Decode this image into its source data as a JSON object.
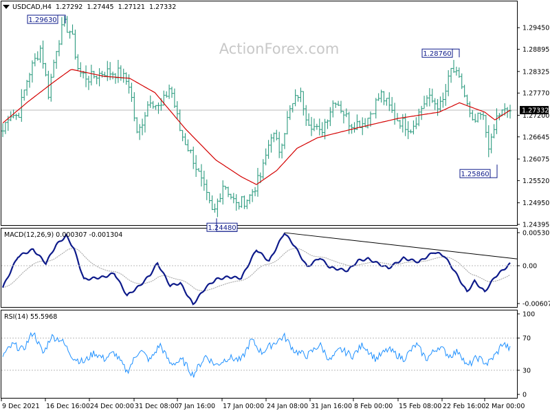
{
  "watermark": "ActionForex.com",
  "chart_data": [
    {
      "type": "candlestick",
      "title": "USDCAD,H4  1.27292  1.27445  1.27121  1.27332",
      "symbol": "USDCAD,H4",
      "ohlc_header": [
        "1.27292",
        "1.27445",
        "1.27121",
        "1.27332"
      ],
      "ylim": [
        1.24395,
        1.3002
      ],
      "y_ticks": [
        "1.29450",
        "1.28895",
        "1.28325",
        "1.27770",
        "1.27200",
        "1.26645",
        "1.26075",
        "1.25520",
        "1.24950",
        "1.24395"
      ],
      "current_price": "1.27332",
      "current_price_value": 1.27332,
      "moving_average_color": "#d40000",
      "bar_color": "#2a9a7e",
      "annotations": [
        {
          "label": "1.29630",
          "date": "16 Dec 2021",
          "value": 1.2963
        },
        {
          "label": "1.24480",
          "date": "17 Jan",
          "value": 1.2448
        },
        {
          "label": "1.28760",
          "date": "22 Feb",
          "value": 1.2876
        },
        {
          "label": "1.25860",
          "date": "28 Feb",
          "value": 1.2586
        }
      ],
      "anchors": [
        {
          "t": 0,
          "v": 1.268
        },
        {
          "t": 0.012,
          "v": 1.2725
        },
        {
          "t": 0.03,
          "v": 1.2718
        },
        {
          "t": 0.05,
          "v": 1.2822
        },
        {
          "t": 0.075,
          "v": 1.2895
        },
        {
          "t": 0.09,
          "v": 1.2776
        },
        {
          "t": 0.105,
          "v": 1.289
        },
        {
          "t": 0.12,
          "v": 1.2955
        },
        {
          "t": 0.135,
          "v": 1.2932
        },
        {
          "t": 0.15,
          "v": 1.283
        },
        {
          "t": 0.17,
          "v": 1.2815
        },
        {
          "t": 0.2,
          "v": 1.2832
        },
        {
          "t": 0.23,
          "v": 1.2828
        },
        {
          "t": 0.25,
          "v": 1.2798
        },
        {
          "t": 0.265,
          "v": 1.2665
        },
        {
          "t": 0.29,
          "v": 1.2765
        },
        {
          "t": 0.31,
          "v": 1.2735
        },
        {
          "t": 0.33,
          "v": 1.2796
        },
        {
          "t": 0.35,
          "v": 1.2678
        },
        {
          "t": 0.375,
          "v": 1.261
        },
        {
          "t": 0.395,
          "v": 1.2535
        },
        {
          "t": 0.415,
          "v": 1.2462
        },
        {
          "t": 0.435,
          "v": 1.2548
        },
        {
          "t": 0.46,
          "v": 1.2488
        },
        {
          "t": 0.485,
          "v": 1.2508
        },
        {
          "t": 0.51,
          "v": 1.2568
        },
        {
          "t": 0.53,
          "v": 1.2678
        },
        {
          "t": 0.545,
          "v": 1.2632
        },
        {
          "t": 0.565,
          "v": 1.2728
        },
        {
          "t": 0.585,
          "v": 1.2782
        },
        {
          "t": 0.6,
          "v": 1.2712
        },
        {
          "t": 0.625,
          "v": 1.2672
        },
        {
          "t": 0.655,
          "v": 1.2764
        },
        {
          "t": 0.685,
          "v": 1.2698
        },
        {
          "t": 0.715,
          "v": 1.2702
        },
        {
          "t": 0.745,
          "v": 1.2775
        },
        {
          "t": 0.775,
          "v": 1.2712
        },
        {
          "t": 0.805,
          "v": 1.2686
        },
        {
          "t": 0.835,
          "v": 1.2764
        },
        {
          "t": 0.865,
          "v": 1.2742
        },
        {
          "t": 0.885,
          "v": 1.2842
        },
        {
          "t": 0.905,
          "v": 1.2795
        },
        {
          "t": 0.925,
          "v": 1.2695
        },
        {
          "t": 0.945,
          "v": 1.2722
        },
        {
          "t": 0.96,
          "v": 1.2632
        },
        {
          "t": 0.975,
          "v": 1.2722
        },
        {
          "t": 1.0,
          "v": 1.2733
        }
      ],
      "ma_anchors": [
        {
          "t": 0,
          "v": 1.27
        },
        {
          "t": 0.05,
          "v": 1.2755
        },
        {
          "t": 0.1,
          "v": 1.2805
        },
        {
          "t": 0.135,
          "v": 1.2838
        },
        {
          "t": 0.2,
          "v": 1.282
        },
        {
          "t": 0.25,
          "v": 1.2815
        },
        {
          "t": 0.3,
          "v": 1.2778
        },
        {
          "t": 0.36,
          "v": 1.2685
        },
        {
          "t": 0.42,
          "v": 1.2605
        },
        {
          "t": 0.47,
          "v": 1.2562
        },
        {
          "t": 0.5,
          "v": 1.2542
        },
        {
          "t": 0.54,
          "v": 1.2578
        },
        {
          "t": 0.58,
          "v": 1.2635
        },
        {
          "t": 0.62,
          "v": 1.2662
        },
        {
          "t": 0.7,
          "v": 1.2688
        },
        {
          "t": 0.78,
          "v": 1.2712
        },
        {
          "t": 0.86,
          "v": 1.2728
        },
        {
          "t": 0.9,
          "v": 1.2752
        },
        {
          "t": 0.95,
          "v": 1.2728
        },
        {
          "t": 0.97,
          "v": 1.2708
        },
        {
          "t": 1.0,
          "v": 1.2733
        }
      ]
    },
    {
      "type": "line",
      "title": "MACD(12,26,9) 0.000307 -0.001304",
      "label": "MACD(12,26,9)",
      "readings": [
        "0.000307",
        "-0.001304"
      ],
      "y_ticks": [
        "0.005307",
        "0.00",
        "-0.006074"
      ],
      "ylim": [
        -0.006074,
        0.005307
      ],
      "macd_color": "#0d1a8a",
      "signal_color": "#a0a0a0",
      "trendline_color": "#000000",
      "trendline": [
        {
          "t": 0.555,
          "v": 0.0053
        },
        {
          "t": 1.0,
          "v": 0.0011
        }
      ],
      "anchors": [
        {
          "t": 0,
          "v": -0.0035
        },
        {
          "t": 0.03,
          "v": 0.0015
        },
        {
          "t": 0.06,
          "v": 0.0026
        },
        {
          "t": 0.085,
          "v": 0.0004
        },
        {
          "t": 0.105,
          "v": 0.0033
        },
        {
          "t": 0.125,
          "v": 0.0048
        },
        {
          "t": 0.14,
          "v": 0.0028
        },
        {
          "t": 0.16,
          "v": -0.0022
        },
        {
          "t": 0.2,
          "v": -0.0018
        },
        {
          "t": 0.22,
          "v": -0.0012
        },
        {
          "t": 0.245,
          "v": -0.0048
        },
        {
          "t": 0.27,
          "v": -0.0032
        },
        {
          "t": 0.29,
          "v": -0.0015
        },
        {
          "t": 0.305,
          "v": 0.0004
        },
        {
          "t": 0.33,
          "v": -0.0032
        },
        {
          "t": 0.35,
          "v": -0.0028
        },
        {
          "t": 0.375,
          "v": -0.0062
        },
        {
          "t": 0.4,
          "v": -0.0035
        },
        {
          "t": 0.42,
          "v": -0.0022
        },
        {
          "t": 0.445,
          "v": -0.0018
        },
        {
          "t": 0.47,
          "v": -0.002
        },
        {
          "t": 0.5,
          "v": 0.0026
        },
        {
          "t": 0.525,
          "v": 0.0007
        },
        {
          "t": 0.555,
          "v": 0.0053
        },
        {
          "t": 0.575,
          "v": 0.0032
        },
        {
          "t": 0.6,
          "v": -0.0002
        },
        {
          "t": 0.625,
          "v": 0.0013
        },
        {
          "t": 0.645,
          "v": -0.0003
        },
        {
          "t": 0.68,
          "v": -0.0008
        },
        {
          "t": 0.7,
          "v": 0.0008
        },
        {
          "t": 0.72,
          "v": 0.0011
        },
        {
          "t": 0.76,
          "v": -0.0004
        },
        {
          "t": 0.79,
          "v": 0.0012
        },
        {
          "t": 0.82,
          "v": 0.0006
        },
        {
          "t": 0.85,
          "v": 0.0022
        },
        {
          "t": 0.87,
          "v": 0.0016
        },
        {
          "t": 0.89,
          "v": -0.0008
        },
        {
          "t": 0.915,
          "v": -0.0042
        },
        {
          "t": 0.93,
          "v": -0.0025
        },
        {
          "t": 0.95,
          "v": -0.0042
        },
        {
          "t": 0.97,
          "v": -0.0018
        },
        {
          "t": 1.0,
          "v": 0.0003
        }
      ]
    },
    {
      "type": "line",
      "title": "RSI(14) 55.5968",
      "label": "RSI(14)",
      "reading": "55.5968",
      "y_ticks": [
        "100",
        "70",
        "30",
        "0"
      ],
      "ylim": [
        0,
        100
      ],
      "levels": [
        70,
        30
      ],
      "line_color": "#1e90ff",
      "anchors": [
        {
          "t": 0,
          "v": 48
        },
        {
          "t": 0.02,
          "v": 62
        },
        {
          "t": 0.04,
          "v": 55
        },
        {
          "t": 0.06,
          "v": 78
        },
        {
          "t": 0.08,
          "v": 50
        },
        {
          "t": 0.095,
          "v": 72
        },
        {
          "t": 0.115,
          "v": 68
        },
        {
          "t": 0.14,
          "v": 45
        },
        {
          "t": 0.16,
          "v": 40
        },
        {
          "t": 0.18,
          "v": 52
        },
        {
          "t": 0.2,
          "v": 44
        },
        {
          "t": 0.22,
          "v": 52
        },
        {
          "t": 0.245,
          "v": 28
        },
        {
          "t": 0.27,
          "v": 56
        },
        {
          "t": 0.29,
          "v": 42
        },
        {
          "t": 0.31,
          "v": 62
        },
        {
          "t": 0.33,
          "v": 38
        },
        {
          "t": 0.355,
          "v": 42
        },
        {
          "t": 0.375,
          "v": 24
        },
        {
          "t": 0.4,
          "v": 48
        },
        {
          "t": 0.42,
          "v": 36
        },
        {
          "t": 0.445,
          "v": 46
        },
        {
          "t": 0.47,
          "v": 42
        },
        {
          "t": 0.49,
          "v": 68
        },
        {
          "t": 0.51,
          "v": 52
        },
        {
          "t": 0.535,
          "v": 64
        },
        {
          "t": 0.555,
          "v": 72
        },
        {
          "t": 0.575,
          "v": 54
        },
        {
          "t": 0.6,
          "v": 48
        },
        {
          "t": 0.625,
          "v": 62
        },
        {
          "t": 0.645,
          "v": 42
        },
        {
          "t": 0.665,
          "v": 56
        },
        {
          "t": 0.69,
          "v": 48
        },
        {
          "t": 0.71,
          "v": 62
        },
        {
          "t": 0.735,
          "v": 44
        },
        {
          "t": 0.76,
          "v": 56
        },
        {
          "t": 0.79,
          "v": 44
        },
        {
          "t": 0.815,
          "v": 62
        },
        {
          "t": 0.835,
          "v": 44
        },
        {
          "t": 0.86,
          "v": 60
        },
        {
          "t": 0.88,
          "v": 48
        },
        {
          "t": 0.9,
          "v": 54
        },
        {
          "t": 0.915,
          "v": 34
        },
        {
          "t": 0.935,
          "v": 46
        },
        {
          "t": 0.955,
          "v": 38
        },
        {
          "t": 0.975,
          "v": 52
        },
        {
          "t": 0.985,
          "v": 64
        },
        {
          "t": 1.0,
          "v": 56
        }
      ]
    }
  ],
  "x_axis": {
    "labels": [
      {
        "text": "9 Dec 2021",
        "t": 0.0
      },
      {
        "text": "16 Dec 16:00",
        "t": 0.1
      },
      {
        "text": "24 Dec 00:00",
        "t": 0.2
      },
      {
        "text": "31 Dec 08:00",
        "t": 0.3
      },
      {
        "text": "7 Jan 16:00",
        "t": 0.4
      },
      {
        "text": "17 Jan 00:00",
        "t": 0.5
      },
      {
        "text": "24 Jan 08:00",
        "t": 0.6
      },
      {
        "text": "31 Jan 16:00",
        "t": 0.7
      },
      {
        "text": "8 Feb 00:00",
        "t": 0.8
      },
      {
        "text": "15 Feb 08:00",
        "t": 0.9
      },
      {
        "text": "22 Feb 16:00",
        "t": 1.0
      },
      {
        "text": "2 Mar 00:00",
        "t": 1.1
      }
    ]
  }
}
